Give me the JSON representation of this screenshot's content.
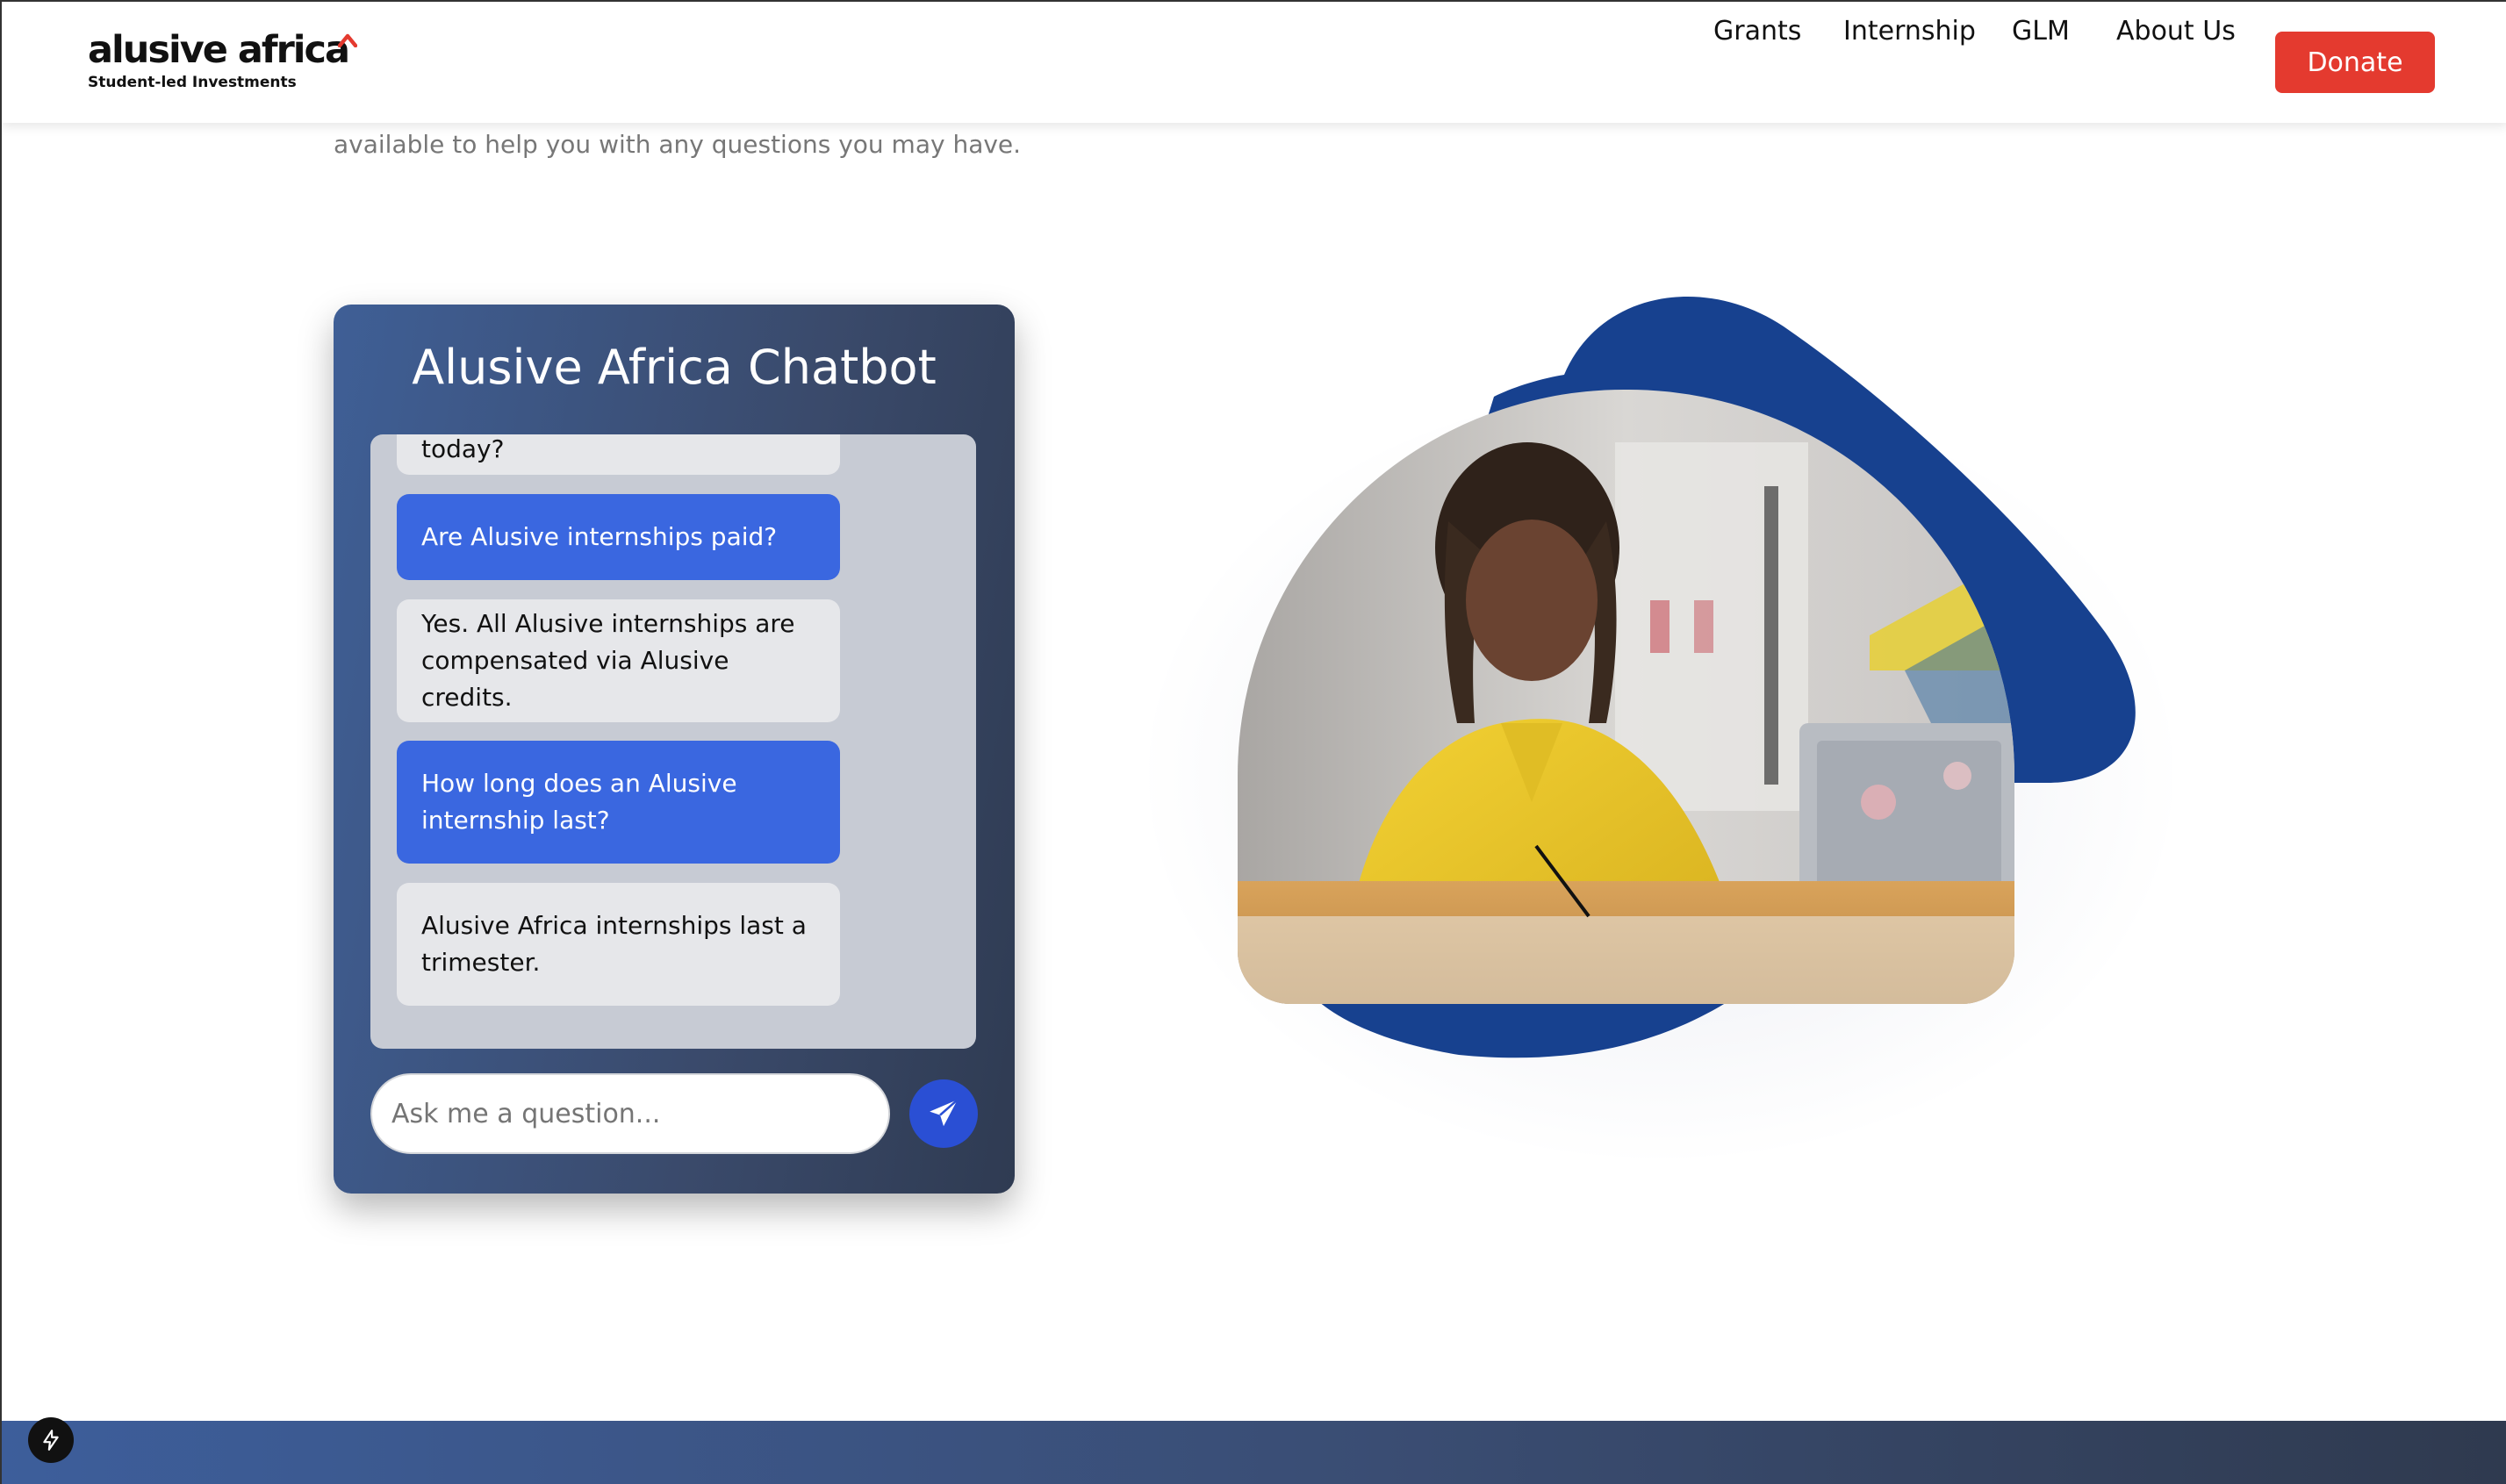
{
  "brand": {
    "name": "alusive africa",
    "tagline": "Student-led Investments",
    "accent_color": "#e43a2f",
    "primary_blue": "#1e3f8f"
  },
  "nav": {
    "items": [
      {
        "label": "Grants"
      },
      {
        "label": "Internship"
      },
      {
        "label": "GLM"
      },
      {
        "label": "About Us"
      }
    ],
    "donate_label": "Donate"
  },
  "intro": {
    "text": "available to help you with any questions you may have."
  },
  "chatbot": {
    "title": "Alusive Africa Chatbot",
    "messages": [
      {
        "role": "bot",
        "text": "Hello! How can I assist you today?"
      },
      {
        "role": "user",
        "text": "Are Alusive internships paid?"
      },
      {
        "role": "bot",
        "text": "Yes. All Alusive internships are compensated via Alusive credits."
      },
      {
        "role": "user",
        "text": "How long does an Alusive internship last?"
      },
      {
        "role": "bot",
        "text": "Alusive Africa internships last a trimester."
      }
    ],
    "input_placeholder": "Ask me a question...",
    "send_icon": "paper-plane-icon"
  },
  "hero": {
    "photo_alt": "Student in yellow shirt writing at a desk with a laptop"
  },
  "floating_icon": "lightning-bolt-icon"
}
